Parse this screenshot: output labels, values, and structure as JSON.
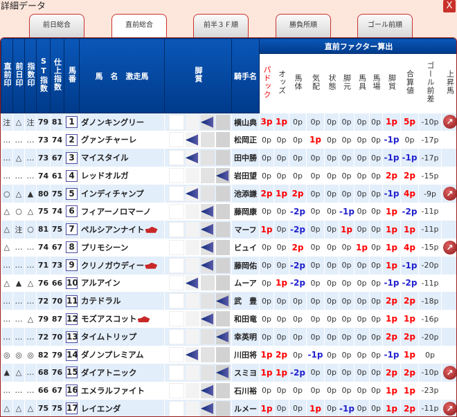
{
  "window": {
    "title": "詳細データ",
    "close": "X"
  },
  "tabs": [
    {
      "label": "前日総合"
    },
    {
      "label": "直前総合"
    },
    {
      "label": "前半３Ｆ順"
    },
    {
      "label": "勝負所順"
    },
    {
      "label": "ゴール前順"
    }
  ],
  "active_tab": 1,
  "headers": {
    "mark_today": "直前印",
    "mark_prev": "前日印",
    "mark_index": "指数印",
    "st_index": "ST指数",
    "shiage_index": "仕上指数",
    "umaban": "馬番",
    "name": "馬　名　激走馬",
    "leg": "脚質",
    "jockey": "騎手名",
    "factor_group": "直前ファクター算出",
    "factors": [
      "パドック",
      "オッズ",
      "馬体",
      "気配",
      "状態",
      "脚元",
      "馬具",
      "馬場",
      "脚質",
      "合算値",
      "ゴール前差",
      "上昇馬"
    ]
  },
  "colors": {
    "positive": "#ff0000",
    "negative": "#2222cc",
    "header": "#0a57b8",
    "accent": "#c8302a"
  },
  "rows": [
    {
      "m1": "注",
      "m2": "△",
      "m3": "注",
      "st": "79",
      "sh": "81",
      "no": "1",
      "name": "ダノンキングリー",
      "gekiso": false,
      "leg": 2,
      "jockey": "横山典",
      "f": [
        "3p",
        "1p",
        "0p",
        "0p",
        "0p",
        "0p",
        "0p",
        "0p",
        "1p",
        "5p",
        "-10p"
      ],
      "up": true
    },
    {
      "m1": "…",
      "m2": "…",
      "m3": "…",
      "st": "73",
      "sh": "74",
      "no": "2",
      "name": "グァンチャーレ",
      "gekiso": false,
      "leg": 1,
      "jockey": "松岡正",
      "f": [
        "0p",
        "0p",
        "0p",
        "1p",
        "0p",
        "0p",
        "0p",
        "0p",
        "-1p",
        "0p",
        "-17p"
      ],
      "up": false
    },
    {
      "m1": "…",
      "m2": "△",
      "m3": "…",
      "st": "73",
      "sh": "67",
      "no": "3",
      "name": "マイスタイル",
      "gekiso": false,
      "leg": 1,
      "jockey": "田中勝",
      "f": [
        "0p",
        "0p",
        "0p",
        "0p",
        "0p",
        "0p",
        "0p",
        "0p",
        "-1p",
        "-1p",
        "-17p"
      ],
      "up": false
    },
    {
      "m1": "…",
      "m2": "…",
      "m3": "…",
      "st": "74",
      "sh": "61",
      "no": "4",
      "name": "レッドオルガ",
      "gekiso": false,
      "leg": 3,
      "jockey": "岩田望",
      "f": [
        "0p",
        "0p",
        "0p",
        "0p",
        "0p",
        "0p",
        "0p",
        "0p",
        "2p",
        "2p",
        "-15p"
      ],
      "up": false
    },
    {
      "m1": "○",
      "m2": "△",
      "m3": "▲",
      "st": "80",
      "sh": "75",
      "no": "5",
      "name": "インディチャンプ",
      "gekiso": false,
      "leg": 1,
      "jockey": "池添謙",
      "f": [
        "2p",
        "1p",
        "2p",
        "0p",
        "0p",
        "0p",
        "0p",
        "0p",
        "-1p",
        "4p",
        "-9p"
      ],
      "up": true
    },
    {
      "m1": "△",
      "m2": "○",
      "m3": "△",
      "st": "75",
      "sh": "74",
      "no": "6",
      "name": "フィアーノロマーノ",
      "gekiso": false,
      "leg": 2,
      "jockey": "藤岡康",
      "f": [
        "0p",
        "0p",
        "-2p",
        "0p",
        "0p",
        "-1p",
        "0p",
        "0p",
        "1p",
        "-2p",
        "-11p"
      ],
      "up": false
    },
    {
      "m1": "△",
      "m2": "注",
      "m3": "○",
      "st": "81",
      "sh": "75",
      "no": "7",
      "name": "ペルシアンナイト",
      "gekiso": true,
      "leg": 2,
      "jockey": "マーフ",
      "f": [
        "1p",
        "0p",
        "-2p",
        "0p",
        "0p",
        "1p",
        "0p",
        "0p",
        "1p",
        "1p",
        "-11p"
      ],
      "up": false
    },
    {
      "m1": "△",
      "m2": "…",
      "m3": "…",
      "st": "74",
      "sh": "67",
      "no": "8",
      "name": "プリモシーン",
      "gekiso": false,
      "leg": 2,
      "jockey": "ビュイ",
      "f": [
        "0p",
        "0p",
        "2p",
        "0p",
        "0p",
        "0p",
        "1p",
        "0p",
        "1p",
        "4p",
        "-15p"
      ],
      "up": true
    },
    {
      "m1": "…",
      "m2": "…",
      "m3": "…",
      "st": "71",
      "sh": "73",
      "no": "9",
      "name": "クリノガウディー",
      "gekiso": true,
      "leg": 2,
      "jockey": "藤岡佑",
      "f": [
        "0p",
        "0p",
        "-2p",
        "0p",
        "0p",
        "0p",
        "0p",
        "0p",
        "1p",
        "-1p",
        "-20p"
      ],
      "up": false
    },
    {
      "m1": "△",
      "m2": "▲",
      "m3": "△",
      "st": "76",
      "sh": "66",
      "no": "10",
      "name": "アルアイン",
      "gekiso": false,
      "leg": 1,
      "jockey": "ムーア",
      "f": [
        "0p",
        "1p",
        "-2p",
        "0p",
        "0p",
        "0p",
        "0p",
        "0p",
        "-1p",
        "-2p",
        "-11p"
      ],
      "up": false
    },
    {
      "m1": "…",
      "m2": "…",
      "m3": "…",
      "st": "72",
      "sh": "70",
      "no": "11",
      "name": "カテドラル",
      "gekiso": false,
      "leg": 3,
      "jockey": "武　豊",
      "f": [
        "0p",
        "0p",
        "0p",
        "0p",
        "0p",
        "0p",
        "0p",
        "0p",
        "2p",
        "2p",
        "-18p"
      ],
      "up": false
    },
    {
      "m1": "…",
      "m2": "…",
      "m3": "△",
      "st": "79",
      "sh": "87",
      "no": "12",
      "name": "モズアスコット",
      "gekiso": true,
      "leg": 2,
      "jockey": "和田竜",
      "f": [
        "0p",
        "0p",
        "0p",
        "0p",
        "0p",
        "0p",
        "0p",
        "0p",
        "1p",
        "1p",
        "-16p"
      ],
      "up": false
    },
    {
      "m1": "…",
      "m2": "…",
      "m3": "…",
      "st": "72",
      "sh": "70",
      "no": "13",
      "name": "タイムトリップ",
      "gekiso": false,
      "leg": 3,
      "jockey": "幸英明",
      "f": [
        "0p",
        "0p",
        "0p",
        "0p",
        "0p",
        "0p",
        "0p",
        "0p",
        "2p",
        "2p",
        "-20p"
      ],
      "up": false
    },
    {
      "m1": "◎",
      "m2": "◎",
      "m3": "◎",
      "st": "82",
      "sh": "79",
      "no": "14",
      "name": "ダノンプレミアム",
      "gekiso": false,
      "leg": 1,
      "jockey": "川田将",
      "f": [
        "1p",
        "2p",
        "0p",
        "-1p",
        "0p",
        "0p",
        "0p",
        "0p",
        "-1p",
        "1p",
        "0p"
      ],
      "up": false
    },
    {
      "m1": "▲",
      "m2": "△",
      "m3": "…",
      "st": "68",
      "sh": "76",
      "no": "15",
      "name": "ダイアトニック",
      "gekiso": false,
      "leg": 3,
      "jockey": "スミヨ",
      "f": [
        "1p",
        "1p",
        "-2p",
        "0p",
        "0p",
        "0p",
        "0p",
        "0p",
        "2p",
        "2p",
        "-10p"
      ],
      "up": true
    },
    {
      "m1": "…",
      "m2": "…",
      "m3": "…",
      "st": "66",
      "sh": "67",
      "no": "16",
      "name": "エメラルファイト",
      "gekiso": false,
      "leg": 2,
      "jockey": "石川裕",
      "f": [
        "0p",
        "0p",
        "0p",
        "0p",
        "0p",
        "0p",
        "0p",
        "0p",
        "1p",
        "1p",
        "-23p"
      ],
      "up": false
    },
    {
      "m1": "△",
      "m2": "△",
      "m3": "△",
      "st": "75",
      "sh": "75",
      "no": "17",
      "name": "レイエンダ",
      "gekiso": false,
      "leg": 2,
      "jockey": "ルメー",
      "f": [
        "1p",
        "0p",
        "0p",
        "1p",
        "0p",
        "-1p",
        "0p",
        "0p",
        "1p",
        "2p",
        "-11p"
      ],
      "up": true
    }
  ]
}
